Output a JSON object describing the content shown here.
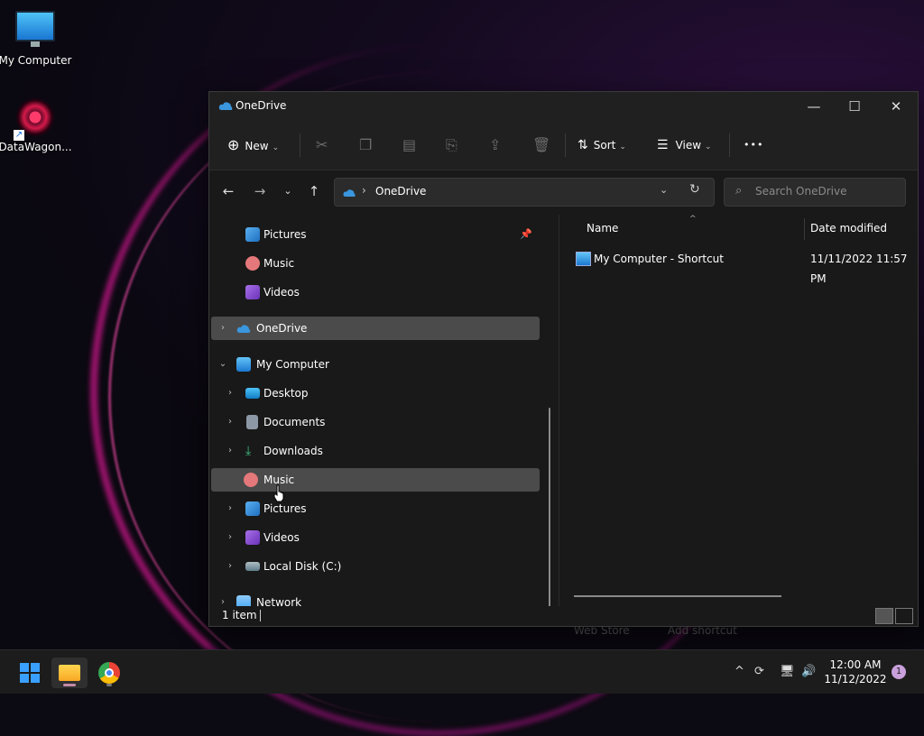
{
  "desktop": {
    "icons": [
      {
        "label": "My Computer"
      },
      {
        "label": "DataWagon..."
      }
    ]
  },
  "window": {
    "title": "OneDrive",
    "controls": {
      "minimize": "—",
      "maximize": "☐",
      "close": "✕"
    }
  },
  "toolbar": {
    "new_label": "New",
    "sort_label": "Sort",
    "view_label": "View",
    "more_label": "•••"
  },
  "address": {
    "path": "OneDrive",
    "separator": "›"
  },
  "search": {
    "placeholder": "Search OneDrive"
  },
  "nav_pane": {
    "items": [
      {
        "label": "Pictures"
      },
      {
        "label": "Music"
      },
      {
        "label": "Videos"
      },
      {
        "label": "OneDrive"
      },
      {
        "label": "My Computer"
      },
      {
        "label": "Desktop"
      },
      {
        "label": "Documents"
      },
      {
        "label": "Downloads"
      },
      {
        "label": "Music"
      },
      {
        "label": "Pictures"
      },
      {
        "label": "Videos"
      },
      {
        "label": "Local Disk (C:)"
      },
      {
        "label": "Network"
      }
    ]
  },
  "content": {
    "columns": {
      "name": "Name",
      "date": "Date modified"
    },
    "rows": [
      {
        "name": "My Computer - Shortcut",
        "date": "11/11/2022 11:57 PM"
      }
    ]
  },
  "status": {
    "item_count": "1 item"
  },
  "behind_window": {
    "text1": "Web Store",
    "text2": "Add shortcut"
  },
  "taskbar": {
    "time": "12:00 AM",
    "date": "11/12/2022",
    "notifications": "1"
  },
  "colors": {
    "accent": "#3aa0ff",
    "selection": "#4b4b4b",
    "window_bg": "#191919"
  }
}
